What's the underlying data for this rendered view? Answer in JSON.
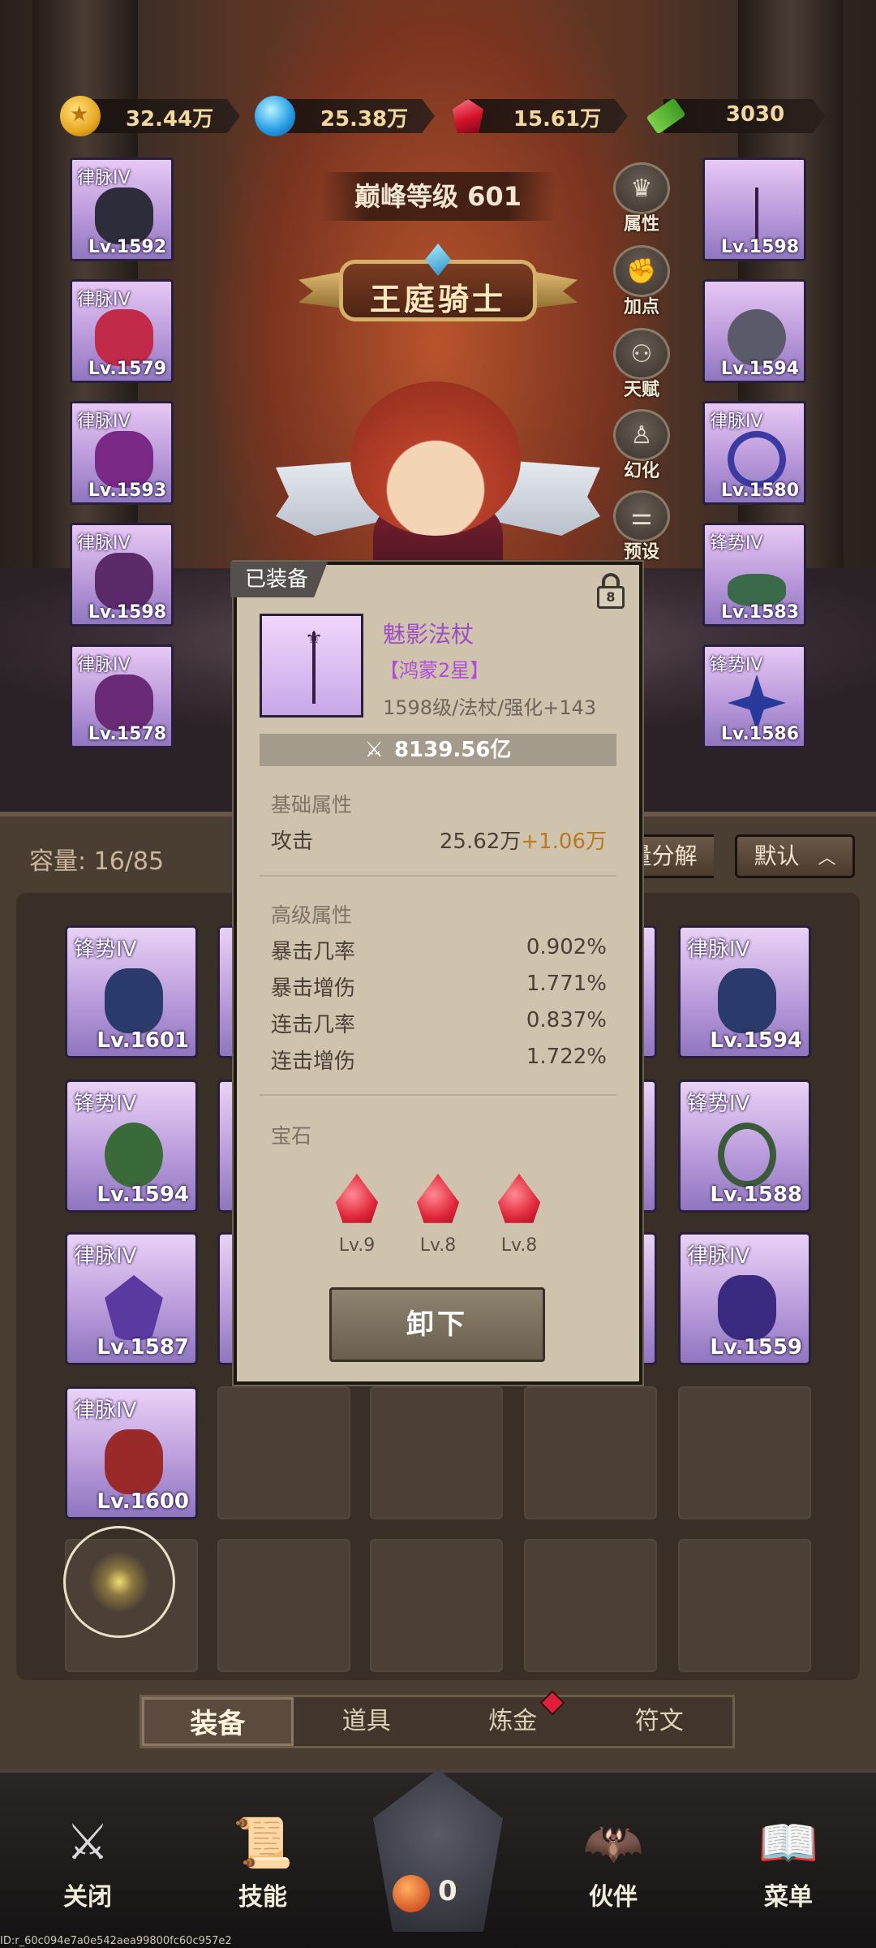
{
  "currencies": [
    {
      "icon": "gold-coin-icon",
      "value": "32.44万"
    },
    {
      "icon": "blue-orb-icon",
      "value": "25.38万"
    },
    {
      "icon": "ruby-gem-icon",
      "value": "15.61万"
    },
    {
      "icon": "cash-icon",
      "value": "3030"
    }
  ],
  "header": {
    "peak_level": "巅峰等级 601",
    "class_title": "王庭骑士"
  },
  "left_slots": [
    {
      "tag": "律脉IV",
      "level": "Lv.1592",
      "color": "#2c2c3a"
    },
    {
      "tag": "律脉IV",
      "level": "Lv.1579",
      "color": "#c22a4a"
    },
    {
      "tag": "律脉IV",
      "level": "Lv.1593",
      "color": "#7a2a86"
    },
    {
      "tag": "律脉IV",
      "level": "Lv.1598",
      "color": "#5a2a6a"
    },
    {
      "tag": "律脉IV",
      "level": "Lv.1578",
      "color": "#6a2a76"
    }
  ],
  "right_slots": [
    {
      "tag": "",
      "level": "Lv.1598",
      "color": "#3a1a40"
    },
    {
      "tag": "",
      "level": "Lv.1594",
      "color": "#5a5a6a"
    },
    {
      "tag": "律脉IV",
      "level": "Lv.1580",
      "color": "#3a3aa0"
    },
    {
      "tag": "锋势IV",
      "level": "Lv.1583",
      "color": "#3a6a4a"
    },
    {
      "tag": "锋势IV",
      "level": "Lv.1586",
      "color": "#2a3a9a"
    }
  ],
  "side_menu": [
    {
      "icon": "attribute-icon",
      "label": "属性"
    },
    {
      "icon": "fist-icon",
      "label": "加点"
    },
    {
      "icon": "talent-tree-icon",
      "label": "天赋"
    },
    {
      "icon": "shirt-icon",
      "label": "幻化"
    },
    {
      "icon": "sliders-icon",
      "label": "预设"
    }
  ],
  "inventory": {
    "capacity": "容量: 16/85",
    "bulk_label": "量分解",
    "sort_label": "默认",
    "items": [
      {
        "tag": "锋势IV",
        "level": "Lv.1601",
        "color": "#2a3a6a"
      },
      {
        "tag": "律脉IV",
        "level": "Lv.1594",
        "color": "#2a3a6a"
      },
      {
        "tag": "锋势IV",
        "level": "Lv.1594",
        "color": "#3a6a3a"
      },
      {
        "tag": "锋势IV",
        "level": "Lv.1588",
        "color": "#3a5a3a"
      },
      {
        "tag": "律脉IV",
        "level": "Lv.1587",
        "color": "#5a3aa0"
      },
      {
        "tag": "律脉IV",
        "level": "Lv.1559",
        "color": "#3a2a80"
      },
      {
        "tag": "律脉IV",
        "level": "Lv.1600",
        "color": "#9a2a2a"
      }
    ]
  },
  "tabs": [
    {
      "label": "装备",
      "active": true
    },
    {
      "label": "道具",
      "active": false
    },
    {
      "label": "炼金",
      "active": false
    },
    {
      "label": "符文",
      "active": false
    }
  ],
  "bottom_nav": {
    "close": "关闭",
    "skills": "技能",
    "center_count": "0",
    "partner": "伙伴",
    "menu": "菜单"
  },
  "popup": {
    "equipped_label": "已装备",
    "lock_count": "8",
    "item_name": "魅影法杖",
    "item_grade": "【鸿蒙2星】",
    "item_meta": "1598级/法杖/强化+143",
    "power": "8139.56亿",
    "basic_title": "基础属性",
    "basic_stats": [
      {
        "name": "攻击",
        "value": "25.62万",
        "bonus": "+1.06万"
      }
    ],
    "advanced_title": "高级属性",
    "advanced_stats": [
      {
        "name": "暴击几率",
        "value": "0.902%"
      },
      {
        "name": "暴击增伤",
        "value": "1.771%"
      },
      {
        "name": "连击几率",
        "value": "0.837%"
      },
      {
        "name": "连击增伤",
        "value": "1.722%"
      }
    ],
    "gem_title": "宝石",
    "gems": [
      {
        "level": "Lv.9"
      },
      {
        "level": "Lv.8"
      },
      {
        "level": "Lv.8"
      }
    ],
    "unequip_label": "卸下"
  },
  "footer_id": "ID:r_60c094e7a0e542aea99800fc60c957e2"
}
